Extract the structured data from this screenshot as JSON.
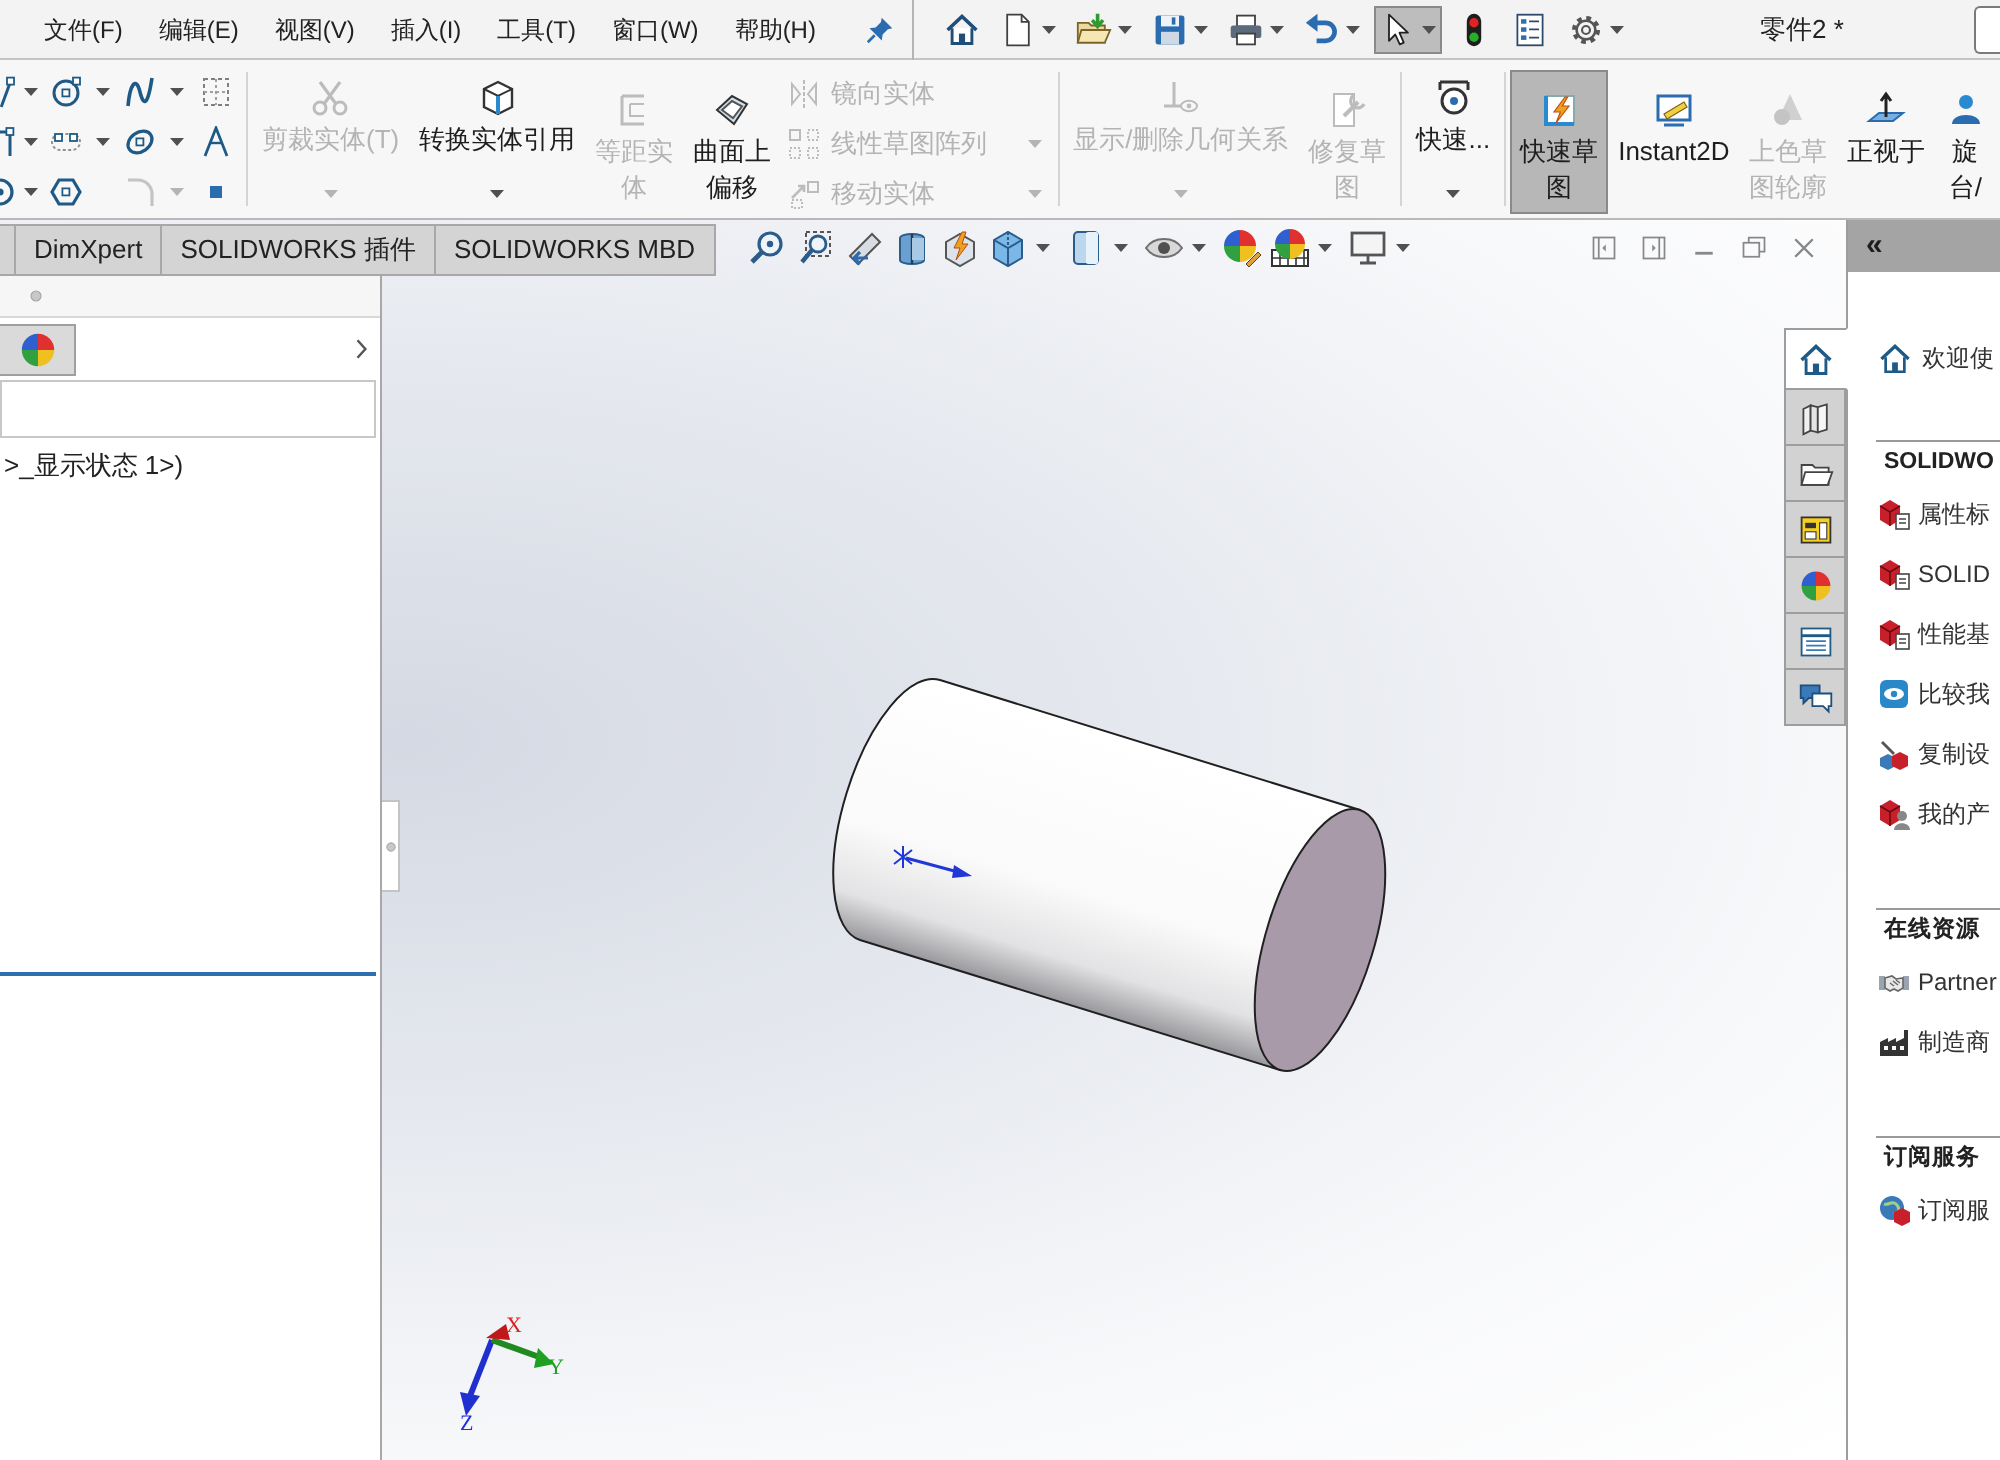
{
  "menu_bar": {
    "items": [
      "文件(F)",
      "编辑(E)",
      "视图(V)",
      "插入(I)",
      "工具(T)",
      "窗口(W)",
      "帮助(H)"
    ]
  },
  "quick_access": [
    {
      "selected": false,
      "dropdown": false
    },
    {
      "selected": false,
      "dropdown": true
    },
    {
      "selected": false,
      "dropdown": true
    },
    {
      "selected": false,
      "dropdown": true
    },
    {
      "selected": false,
      "dropdown": true
    },
    {
      "selected": false,
      "dropdown": true
    },
    {
      "selected": true,
      "dropdown": true
    },
    {
      "selected": false,
      "dropdown": false
    },
    {
      "selected": false,
      "dropdown": false
    },
    {
      "selected": false,
      "dropdown": true
    }
  ],
  "document_title": "零件2 *",
  "ribbon": {
    "sketch_tools": [
      {
        "dropdown": true,
        "disabled": false
      },
      {
        "dropdown": true,
        "disabled": false
      },
      {
        "dropdown": true,
        "disabled": false
      },
      {
        "dropdown": false,
        "disabled": false
      },
      {
        "dropdown": true,
        "disabled": false
      },
      {
        "dropdown": true,
        "disabled": false
      },
      {
        "dropdown": true,
        "disabled": false
      },
      {
        "dropdown": false,
        "disabled": false
      },
      {
        "dropdown": true,
        "disabled": false
      },
      {
        "dropdown": false,
        "disabled": false
      },
      {
        "dropdown": true,
        "disabled": true
      },
      {
        "dropdown": false,
        "disabled": false
      }
    ],
    "groups": [
      {
        "buttons": [
          {
            "kind": "large",
            "lines": [
              "剪裁实体(T)"
            ],
            "disabled": true,
            "selected": false,
            "dropdown": true
          },
          {
            "kind": "large",
            "lines": [
              "转换实体引用"
            ],
            "disabled": false,
            "selected": false,
            "dropdown": true
          },
          {
            "kind": "large",
            "lines": [
              "等距实",
              "体"
            ],
            "disabled": true,
            "selected": false,
            "dropdown": false
          },
          {
            "kind": "large",
            "lines": [
              "曲面上",
              "偏移"
            ],
            "disabled": false,
            "selected": false,
            "dropdown": false
          },
          {
            "kind": "stack",
            "items": [
              {
                "label": "镜向实体",
                "disabled": true,
                "selected": false,
                "dropdown": false
              },
              {
                "label": "线性草图阵列",
                "disabled": true,
                "selected": false,
                "dropdown": true
              },
              {
                "label": "移动实体",
                "disabled": true,
                "selected": false,
                "dropdown": true
              }
            ]
          }
        ]
      },
      {
        "buttons": [
          {
            "kind": "large",
            "lines": [
              "显示/删除几何关系"
            ],
            "disabled": true,
            "selected": false,
            "dropdown": true
          },
          {
            "kind": "large",
            "lines": [
              "修复草",
              "图"
            ],
            "disabled": true,
            "selected": false,
            "dropdown": false
          }
        ]
      },
      {
        "buttons": [
          {
            "kind": "large",
            "lines": [
              "快速..."
            ],
            "disabled": false,
            "selected": false,
            "dropdown": true
          }
        ]
      },
      {
        "buttons": [
          {
            "kind": "large",
            "lines": [
              "快速草",
              "图"
            ],
            "disabled": false,
            "selected": true,
            "dropdown": false
          },
          {
            "kind": "large",
            "lines": [
              "Instant2D"
            ],
            "disabled": false,
            "selected": false,
            "dropdown": false
          },
          {
            "kind": "large",
            "lines": [
              "上色草",
              "图轮廓"
            ],
            "disabled": true,
            "selected": false,
            "dropdown": false
          },
          {
            "kind": "large",
            "lines": [
              "正视于"
            ],
            "disabled": false,
            "selected": false,
            "dropdown": false
          },
          {
            "kind": "large",
            "lines": [
              "旋",
              "台/"
            ],
            "disabled": false,
            "selected": false,
            "dropdown": false
          }
        ]
      }
    ]
  },
  "tabs": [
    {
      "label": "DimXpert",
      "selected": false
    },
    {
      "label": "SOLIDWORKS 插件",
      "selected": false
    },
    {
      "label": "SOLIDWORKS MBD",
      "selected": false
    }
  ],
  "feature_manager": {
    "panel_tabs": [
      {
        "selected": true
      }
    ],
    "tree_items": [
      ">_显示状态 1>)"
    ]
  },
  "graphics": {
    "triad_axes": [
      "X",
      "Y",
      "Z"
    ]
  },
  "task_pane": {
    "collapse_glyph": "«",
    "tabs": [
      {
        "selected": true
      },
      {
        "selected": false
      },
      {
        "selected": false
      },
      {
        "selected": false
      },
      {
        "selected": false
      },
      {
        "selected": false
      },
      {
        "selected": false
      }
    ],
    "welcome": "欢迎使",
    "sections": [
      {
        "title": "SOLIDWO",
        "items": [
          "属性标",
          "SOLID",
          "性能基",
          "比较我",
          "复制设",
          "我的产"
        ]
      },
      {
        "title": "在线资源",
        "items": [
          "Partner",
          "制造商"
        ]
      },
      {
        "title": "订阅服务",
        "items": [
          "订阅服"
        ]
      }
    ]
  }
}
